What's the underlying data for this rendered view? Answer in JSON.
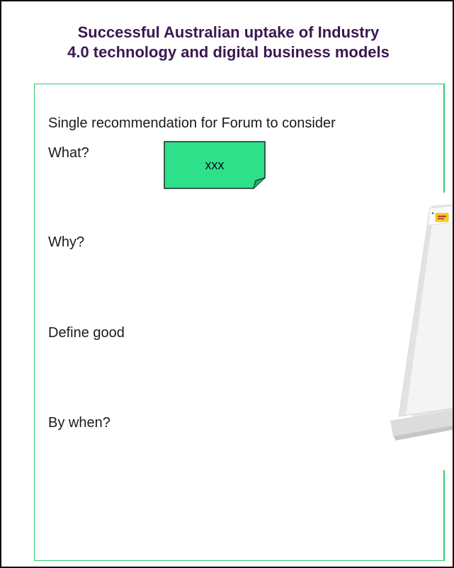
{
  "slide": {
    "title_line1": "Successful Australian uptake of Industry",
    "title_line2": "4.0 technology and digital business models",
    "heading": "Single recommendation for Forum to consider",
    "fields": {
      "what": "What?",
      "why": "Why?",
      "define_good": "Define good",
      "by_when": "By when?"
    },
    "sticky_note": {
      "text": "xxx",
      "color": "#2ee08a"
    },
    "easel_pad_icon": "post-it-easel-pad-icon"
  },
  "colors": {
    "title": "#3b1751",
    "frame": "#2ecc71",
    "page_border": "#111111"
  }
}
